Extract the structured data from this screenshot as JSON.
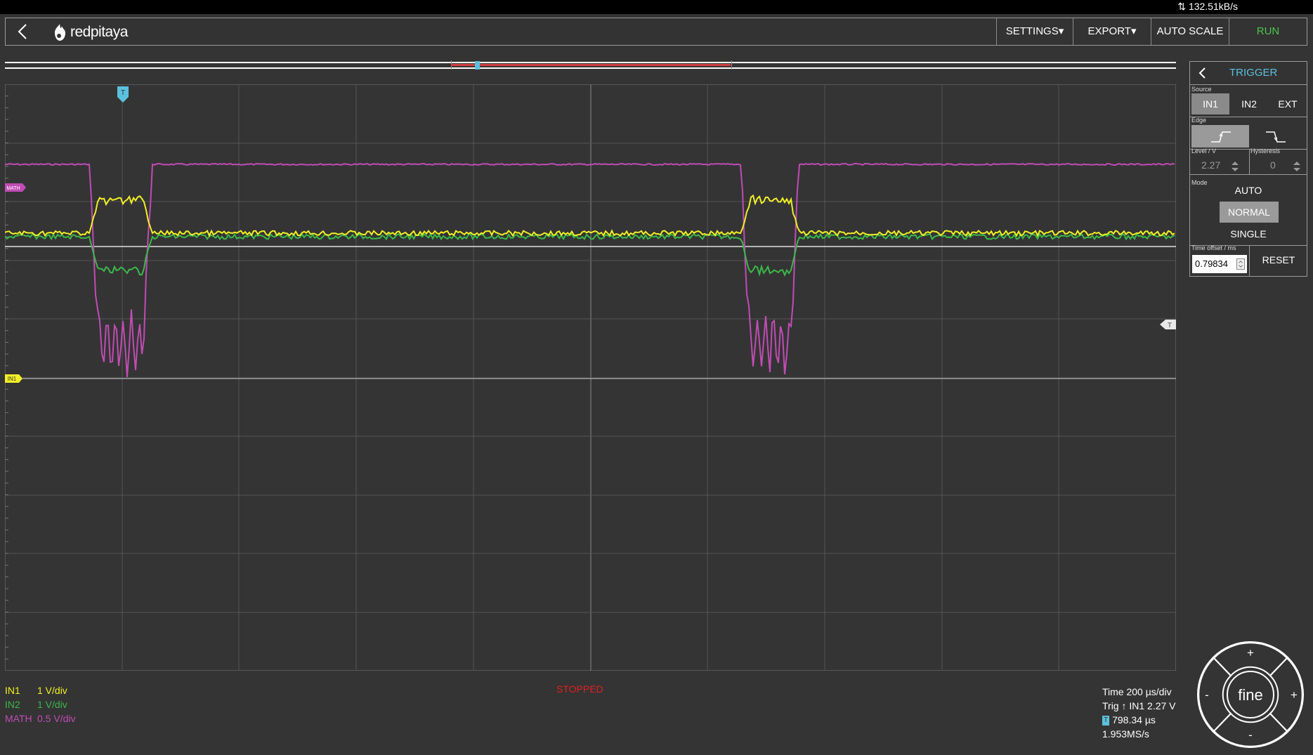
{
  "status_bar": {
    "rate": "132.51kB/s"
  },
  "header": {
    "logo_text": "redpitaya",
    "menu": {
      "settings": "SETTINGS▾",
      "export": "EXPORT▾",
      "autoscale": "AUTO SCALE",
      "run": "RUN"
    }
  },
  "channels": [
    {
      "name": "IN1",
      "scale": "1 V/div",
      "color": "#f0f024"
    },
    {
      "name": "IN2",
      "scale": "1 V/div",
      "color": "#3bb84a"
    },
    {
      "name": "MATH",
      "scale": "0.5 V/div",
      "color": "#c04cb4"
    }
  ],
  "plot": {
    "status": "STOPPED",
    "marker_labels": {
      "trigger_time": "T",
      "math": "MATH",
      "in1": "IN1",
      "trigger_level": "T"
    },
    "grid": {
      "cols": 10,
      "rows": 10
    }
  },
  "time_info": {
    "time": "Time 200 µs/div",
    "trig": "Trig ↑ IN1 2.27 V",
    "t_badge": "T",
    "t_offset": "798.34 µs",
    "sample_rate": "1.953MS/s"
  },
  "trigger_panel": {
    "title": "TRIGGER",
    "source_label": "Source",
    "sources": [
      "IN1",
      "IN2",
      "EXT"
    ],
    "selected_source": "IN1",
    "edge_label": "Edge",
    "selected_edge": "rising",
    "level_label": "Level / V",
    "level_value": "2.27",
    "hysteresis_label": "Hysteresis",
    "hysteresis_value": "0",
    "mode_label": "Mode",
    "modes": [
      "AUTO",
      "NORMAL",
      "SINGLE"
    ],
    "selected_mode": "NORMAL",
    "offset_label": "Time offset / ms",
    "offset_value": "0.79834",
    "reset_label": "RESET"
  },
  "joystick": {
    "center": "fine",
    "up": "+",
    "down": "-",
    "left": "-",
    "right": "+"
  },
  "colors": {
    "accent": "#5bc0de",
    "run": "#4ec44e",
    "stopped": "#e02020",
    "background": "#343434"
  }
}
